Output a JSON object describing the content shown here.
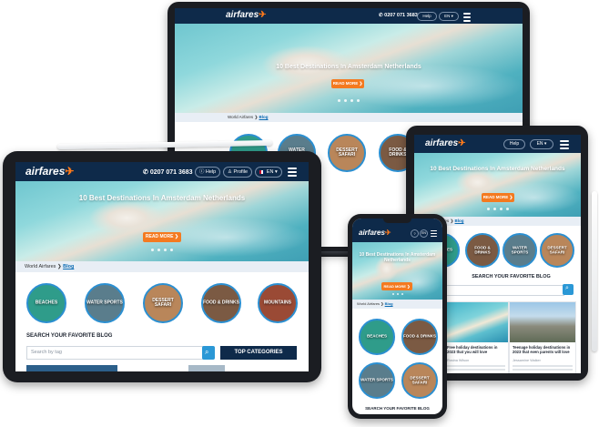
{
  "brand": {
    "top": "WORLD",
    "name": "airfares",
    "jet": "✈"
  },
  "header": {
    "phone": "0207 071 3683",
    "help": "Help",
    "profile": "Profile",
    "lang": "EN"
  },
  "hero": {
    "title": "10 Best Destinations In Amsterdam Netherlands",
    "cta": "READ MORE ❯"
  },
  "breadcrumb": {
    "home": "World Airfares",
    "sep": "❯",
    "current": "Blog"
  },
  "categories": [
    {
      "label": "BEACHES",
      "color": "#2f9c8a"
    },
    {
      "label": "WATER SPORTS",
      "color": "#5a7d8c"
    },
    {
      "label": "DESSERT SAFARI",
      "color": "#b9865a"
    },
    {
      "label": "FOOD & DRINKS",
      "color": "#7b5a43"
    },
    {
      "label": "MOUNTAINS",
      "color": "#9a4a35"
    }
  ],
  "search": {
    "heading": "SEARCH YOUR FAVORITE BLOG",
    "placeholder": "Search by tag",
    "top_categories": "TOP CATEGORIES"
  },
  "posts": [
    {
      "title": "Free holiday destinations in 2023 that you will love",
      "author": "Rosina Wilson"
    },
    {
      "title": "Teenage holiday destinations in 2023 that even parents will love",
      "author": "Jessamine Walker"
    }
  ]
}
